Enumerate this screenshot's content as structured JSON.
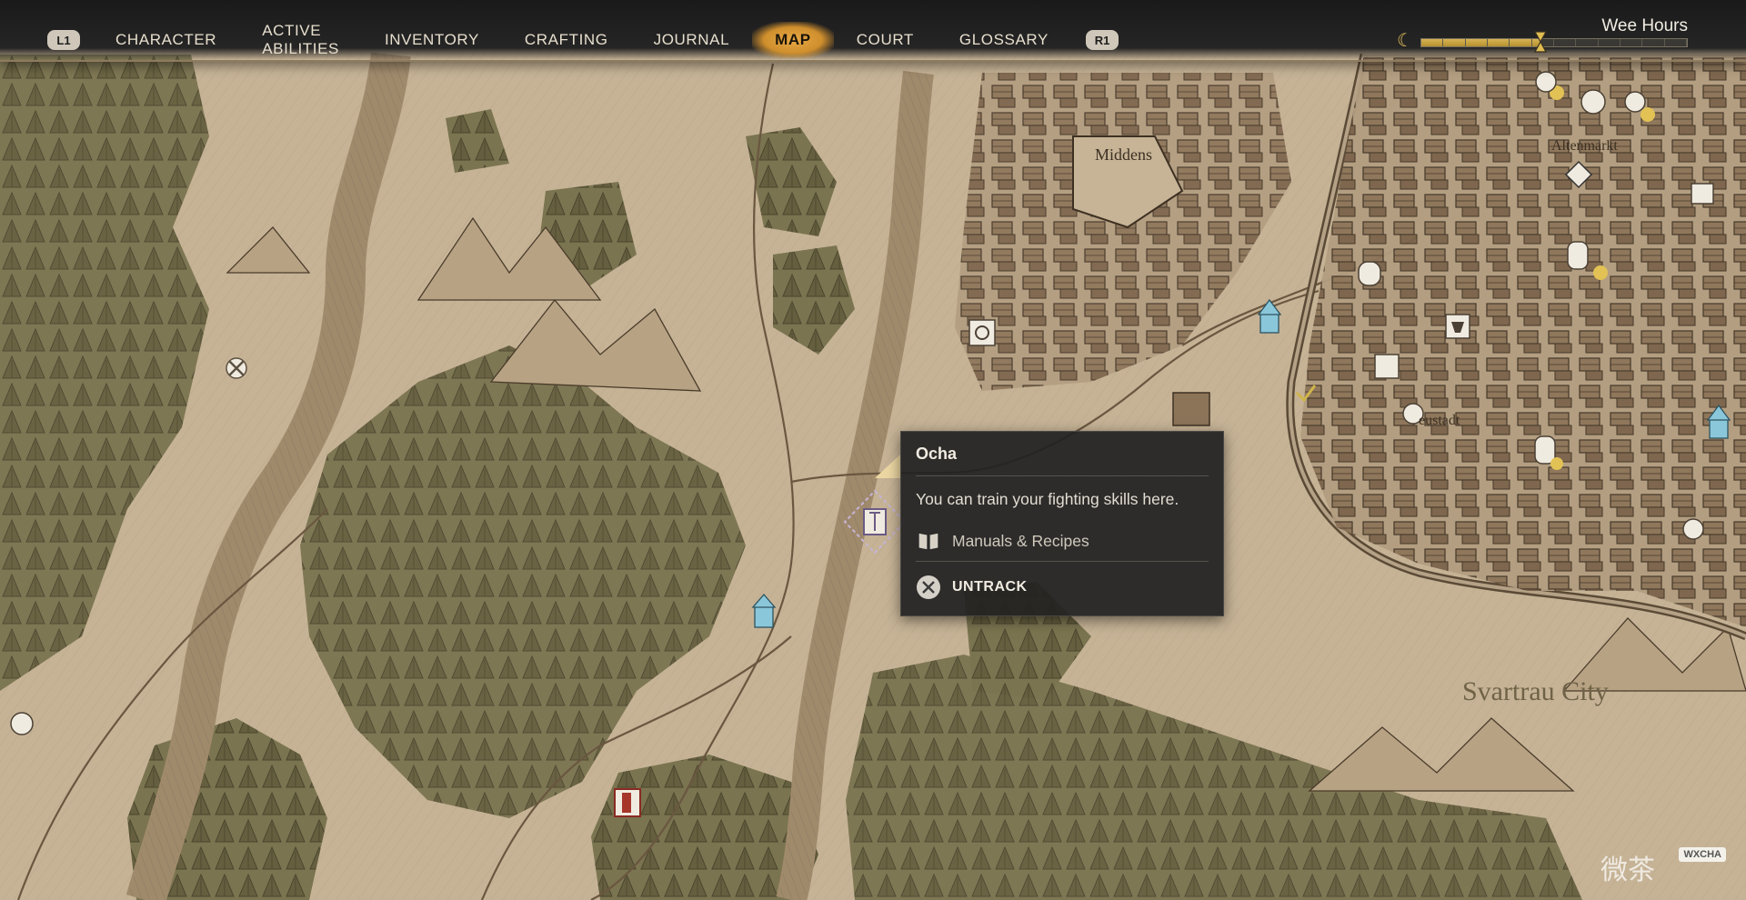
{
  "nav": {
    "left_hint": "L1",
    "right_hint": "R1",
    "items": [
      {
        "label": "CHARACTER",
        "active": false
      },
      {
        "label": "ACTIVE ABILITIES",
        "active": false
      },
      {
        "label": "INVENTORY",
        "active": false
      },
      {
        "label": "CRAFTING",
        "active": false
      },
      {
        "label": "JOURNAL",
        "active": false
      },
      {
        "label": "MAP",
        "active": true
      },
      {
        "label": "COURT",
        "active": false
      },
      {
        "label": "GLOSSARY",
        "active": false
      }
    ]
  },
  "time": {
    "label": "Wee Hours",
    "progress": 0.45,
    "icons": [
      "moon-icon",
      "hourglass-icon"
    ]
  },
  "tooltip": {
    "title": "Ocha",
    "description": "You can train your fighting skills here.",
    "category_icon": "book-icon",
    "category": "Manuals & Recipes",
    "action_icon": "cross-button-icon",
    "action": "UNTRACK"
  },
  "map_labels": {
    "middens": "Middens",
    "altenmarkt": "Altenmarkt",
    "neustadt": "eustadt",
    "city": "Svartrau City"
  },
  "watermark": {
    "text": "微茶",
    "badge": "WXCHA"
  },
  "colors": {
    "parchment": "#c8b59a",
    "forest": "#6f6a48",
    "topbar": "#222121",
    "active_tab": "#d99a37",
    "time_fill": "#c9a441",
    "tooltip_bg": "#222121"
  }
}
